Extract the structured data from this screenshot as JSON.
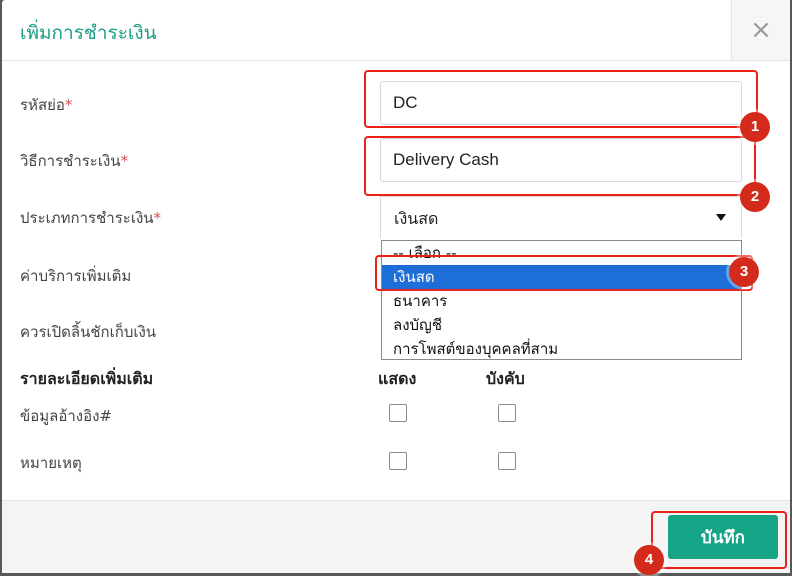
{
  "dialog": {
    "title": "เพิ่มการชำระเงิน",
    "close_symbol": "×"
  },
  "form": {
    "code": {
      "label": "รหัสย่อ",
      "required_mark": "*",
      "value": "DC"
    },
    "method": {
      "label": "วิธีการชำระเงิน",
      "required_mark": "*",
      "value": "Delivery Cash"
    },
    "type": {
      "label": "ประเภทการชำระเงิน",
      "required_mark": "*",
      "selected": "เงินสด",
      "options": [
        "-- เลือก --",
        "เงินสด",
        "ธนาคาร",
        "ลงบัญชี",
        "การโพสต์ของบุคคลที่สาม"
      ],
      "highlighted_index": 1
    },
    "extra_fee_label": "ค่าบริการเพิ่มเติม",
    "cash_drawer_label": "ควรเปิดลิ้นชักเก็บเงิน"
  },
  "details": {
    "heading": "รายละเอียดเพิ่มเติม",
    "col_show": "แสดง",
    "col_required": "บังคับ",
    "rows": [
      {
        "label": "ข้อมูลอ้างอิง#",
        "show": false,
        "required": false
      },
      {
        "label": "หมายเหตุ",
        "show": false,
        "required": false
      }
    ]
  },
  "footer": {
    "save_label": "บันทึก"
  },
  "annotations": {
    "markers": [
      "1",
      "2",
      "3",
      "4"
    ],
    "color": "#e8211b"
  },
  "colors": {
    "accent": "#16a486",
    "title": "#1a9e86",
    "selected_option": "#1e6ed8",
    "required": "#d9534f"
  }
}
